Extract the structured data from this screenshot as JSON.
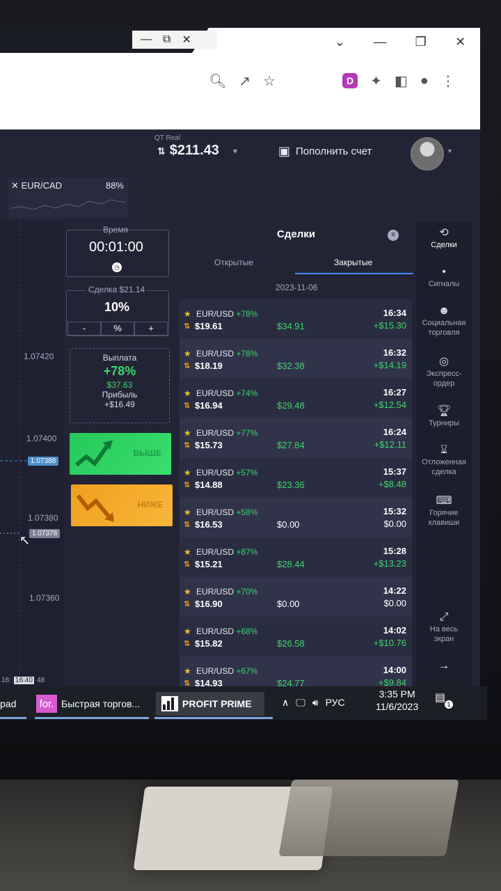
{
  "browser": {
    "window_controls": [
      "—",
      "⧉",
      "✕"
    ],
    "window_controls_right": [
      "⌄",
      "—",
      "❐",
      "✕"
    ],
    "ext_letter": "D"
  },
  "header": {
    "account_label": "QT Real",
    "balance": "$211.43",
    "deposit_label": "Пополнить счет"
  },
  "asset_tab": {
    "name": "EUR/CAD",
    "percent": "88%"
  },
  "chart": {
    "price_labels": [
      "1.07420",
      "1.07400",
      "1.07380",
      "1.07360"
    ],
    "price_tag_1": "1.07388",
    "price_tag_2": "1.07378",
    "bottom_times": [
      "16:",
      "16:40",
      "48"
    ]
  },
  "trade_panel": {
    "time_label": "Время",
    "time_value": "00:01:00",
    "deal_label": "Сделка $21.14",
    "deal_value": "10%",
    "step_minus": "-",
    "step_percent": "%",
    "step_plus": "+",
    "payout_label": "Выплата",
    "payout_percent": "+78%",
    "payout_amount": "$37.63",
    "profit_label": "Прибыль",
    "profit_amount": "+$16.49",
    "up_label": "ВЫШЕ",
    "down_label": "НИЖЕ"
  },
  "deals": {
    "title": "Сделки",
    "tab_open": "Открытые",
    "tab_closed": "Закрытые",
    "date": "2023-11-06",
    "rows": [
      {
        "pair": "EUR/USD",
        "pct": "+78%",
        "amount": "$19.61",
        "payout": "$34.91",
        "time": "16:34",
        "profit": "+$15.30"
      },
      {
        "pair": "EUR/USD",
        "pct": "+78%",
        "amount": "$18.19",
        "payout": "$32.38",
        "time": "16:32",
        "profit": "+$14.19"
      },
      {
        "pair": "EUR/USD",
        "pct": "+74%",
        "amount": "$16.94",
        "payout": "$29.48",
        "time": "16:27",
        "profit": "+$12.54"
      },
      {
        "pair": "EUR/USD",
        "pct": "+77%",
        "amount": "$15.73",
        "payout": "$27.84",
        "time": "16:24",
        "profit": "+$12.11"
      },
      {
        "pair": "EUR/USD",
        "pct": "+57%",
        "amount": "$14.88",
        "payout": "$23.36",
        "time": "15:37",
        "profit": "+$8.48"
      },
      {
        "pair": "EUR/USD",
        "pct": "+58%",
        "amount": "$16.53",
        "payout": "$0.00",
        "time": "15:32",
        "profit": "$0.00"
      },
      {
        "pair": "EUR/USD",
        "pct": "+87%",
        "amount": "$15.21",
        "payout": "$28.44",
        "time": "15:28",
        "profit": "+$13.23"
      },
      {
        "pair": "EUR/USD",
        "pct": "+70%",
        "amount": "$16.90",
        "payout": "$0.00",
        "time": "14:22",
        "profit": "$0.00"
      },
      {
        "pair": "EUR/USD",
        "pct": "+68%",
        "amount": "$15.82",
        "payout": "$26.58",
        "time": "14:02",
        "profit": "+$10.76"
      },
      {
        "pair": "EUR/USD",
        "pct": "+67%",
        "amount": "$14.93",
        "payout": "$24.77",
        "time": "14:00",
        "profit": "+$9.84"
      }
    ]
  },
  "sidebar": {
    "deals": "Сделки",
    "signals": "Сигналы",
    "social_1": "Социальная",
    "social_2": "торговля",
    "express_1": "Экспресс-",
    "express_2": "ордер",
    "tournaments": "Турниры",
    "pending_1": "Отложенная",
    "pending_2": "сделка",
    "hotkeys_1": "Горячие",
    "hotkeys_2": "клавиши",
    "fullscreen_1": "На весь",
    "fullscreen_2": "экран"
  },
  "taskbar": {
    "item1": "pad",
    "for_icon": "for.",
    "item2": "Быстрая торгов...",
    "item3": "PROFIT PRIME",
    "lang": "РУС",
    "time": "3:35 PM",
    "date": "11/6/2023",
    "notify_count": "1"
  },
  "colors": {
    "up": "#26c85a",
    "down": "#f0a020",
    "accent": "#3f8ef5",
    "profit": "#3dd66b"
  }
}
